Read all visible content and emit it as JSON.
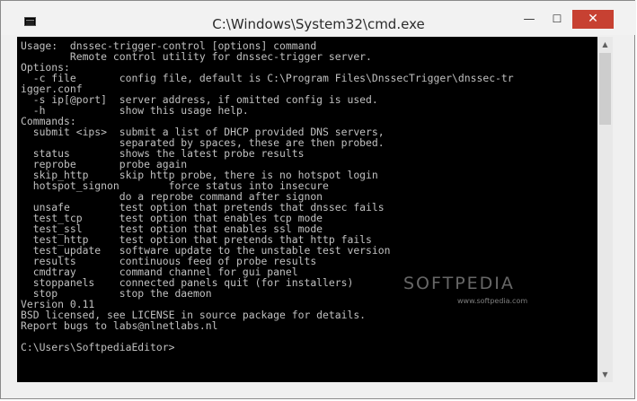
{
  "window": {
    "title": "C:\\Windows\\System32\\cmd.exe",
    "icon": "cmd-icon",
    "controls": {
      "minimize": "—",
      "maximize": "☐",
      "close": "✕"
    }
  },
  "console": {
    "text": "Usage:  dnssec-trigger-control [options] command\n        Remote control utility for dnssec-trigger server.\nOptions:\n  -c file       config file, default is C:\\Program Files\\DnssecTrigger\\dnssec-tr\nigger.conf\n  -s ip[@port]  server address, if omitted config is used.\n  -h            show this usage help.\nCommands:\n  submit <ips>  submit a list of DHCP provided DNS servers,\n                separated by spaces, these are then probed.\n  status        shows the latest probe results\n  reprobe       probe again\n  skip_http     skip http probe, there is no hotspot login\n  hotspot_signon        force status into insecure\n                do a reprobe command after signon\n  unsafe        test option that pretends that dnssec fails\n  test_tcp      test option that enables tcp mode\n  test_ssl      test option that enables ssl mode\n  test_http     test option that pretends that http fails\n  test_update   software update to the unstable test version\n  results       continuous feed of probe results\n  cmdtray       command channel for gui panel\n  stoppanels    connected panels quit (for installers)\n  stop          stop the daemon\nVersion 0.11\nBSD licensed, see LICENSE in source package for details.\nReport bugs to labs@nlnetlabs.nl\n\nC:\\Users\\SoftpediaEditor>"
  },
  "scrollbar": {
    "up": "▲",
    "down": "▼"
  },
  "watermark": {
    "name": "SOFTPEDIA",
    "url": "www.softpedia.com"
  },
  "colors": {
    "console_bg": "#000000",
    "console_fg": "#c0c0c0",
    "close_button": "#c74132"
  }
}
